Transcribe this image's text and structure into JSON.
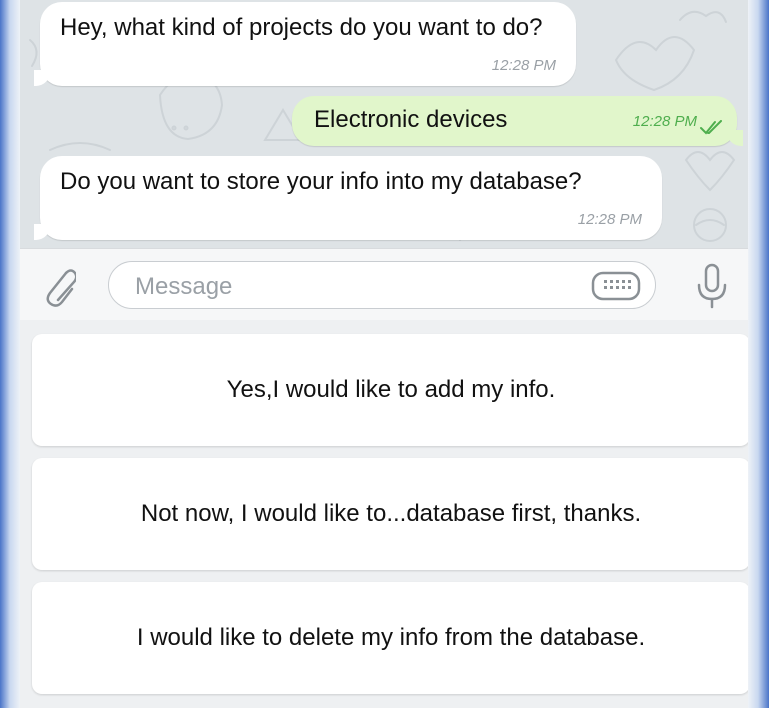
{
  "messages": [
    {
      "direction": "incoming",
      "text": "Hey, what kind of projects do you want to do?",
      "time": "12:28 PM"
    },
    {
      "direction": "outgoing",
      "text": "Electronic devices",
      "time": "12:28 PM",
      "status": "read"
    },
    {
      "direction": "incoming",
      "text": "Do you want to store your info into my database?",
      "time": "12:28 PM"
    }
  ],
  "composer": {
    "placeholder": "Message",
    "attach_icon": "paperclip-icon",
    "keyboard_icon": "keyboard-icon",
    "mic_icon": "microphone-icon"
  },
  "reply_keyboard": {
    "buttons": [
      {
        "label": "Yes,I would like to add my info."
      },
      {
        "label": "Not now, I would like to...database first, thanks."
      },
      {
        "label": "I would like to delete my info from the database."
      }
    ]
  },
  "colors": {
    "incoming_bubble": "#ffffff",
    "outgoing_bubble": "#e1f6cb",
    "read_check": "#4fae4e",
    "chat_background": "#dee3e6",
    "frame_accent": "#4a74c8"
  }
}
